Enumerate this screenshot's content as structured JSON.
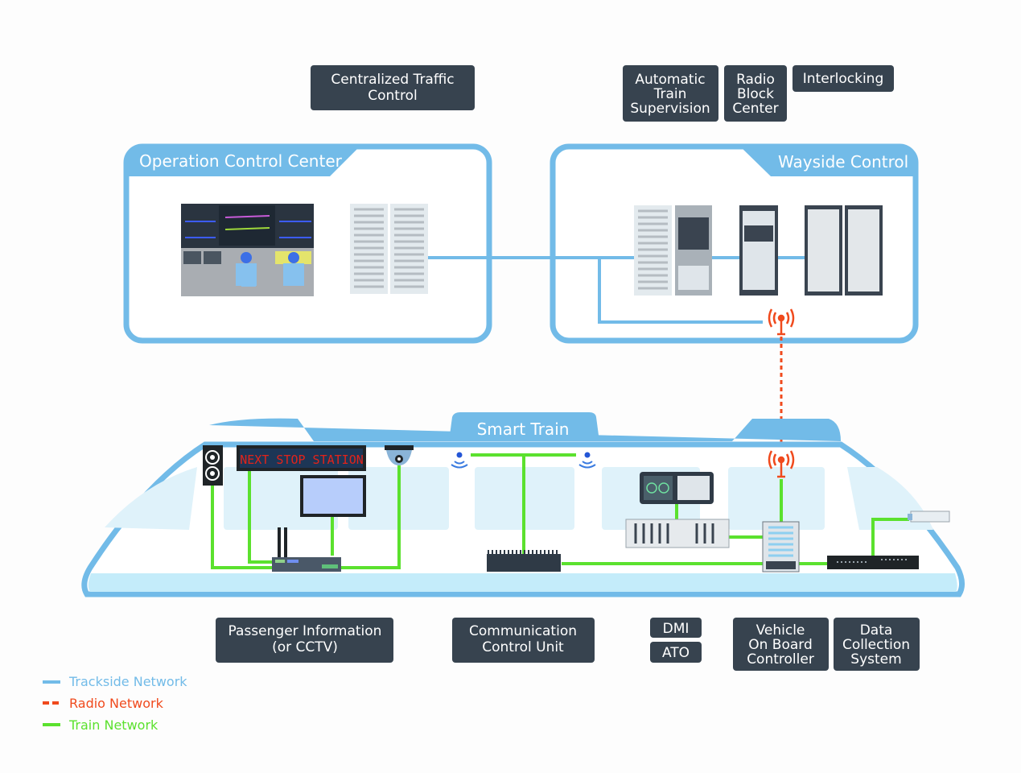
{
  "colors": {
    "trackside": "#72bbe8",
    "radio": "#f04a1d",
    "train": "#5be12e",
    "label_bg": "#37434f",
    "train_light": "#c4ecfa"
  },
  "top_labels": {
    "ctc": [
      "Centralized Traffic",
      "Control"
    ],
    "ats": [
      "Automatic",
      "Train",
      "Supervision"
    ],
    "rbc": [
      "Radio",
      "Block",
      "Center"
    ],
    "interlocking": "Interlocking"
  },
  "occ": {
    "title": "Operation Control Center"
  },
  "wayside": {
    "title": "Wayside Control"
  },
  "train": {
    "title": "Smart Train",
    "sign_text": "NEXT STOP STATION"
  },
  "bottom_labels": {
    "pis": [
      "Passenger Information",
      "(or CCTV)"
    ],
    "ccu": [
      "Communication",
      "Control Unit"
    ],
    "dmi": "DMI",
    "ato": "ATO",
    "vobc": [
      "Vehicle",
      "On Board",
      "Controller"
    ],
    "dcs": [
      "Data",
      "Collection",
      "System"
    ]
  },
  "legend": [
    {
      "label": "Trackside Network",
      "style": "solid",
      "color": "#72bbe8"
    },
    {
      "label": "Radio Network",
      "style": "dashed",
      "color": "#f04a1d"
    },
    {
      "label": "Train Network",
      "style": "solid",
      "color": "#5be12e"
    }
  ]
}
